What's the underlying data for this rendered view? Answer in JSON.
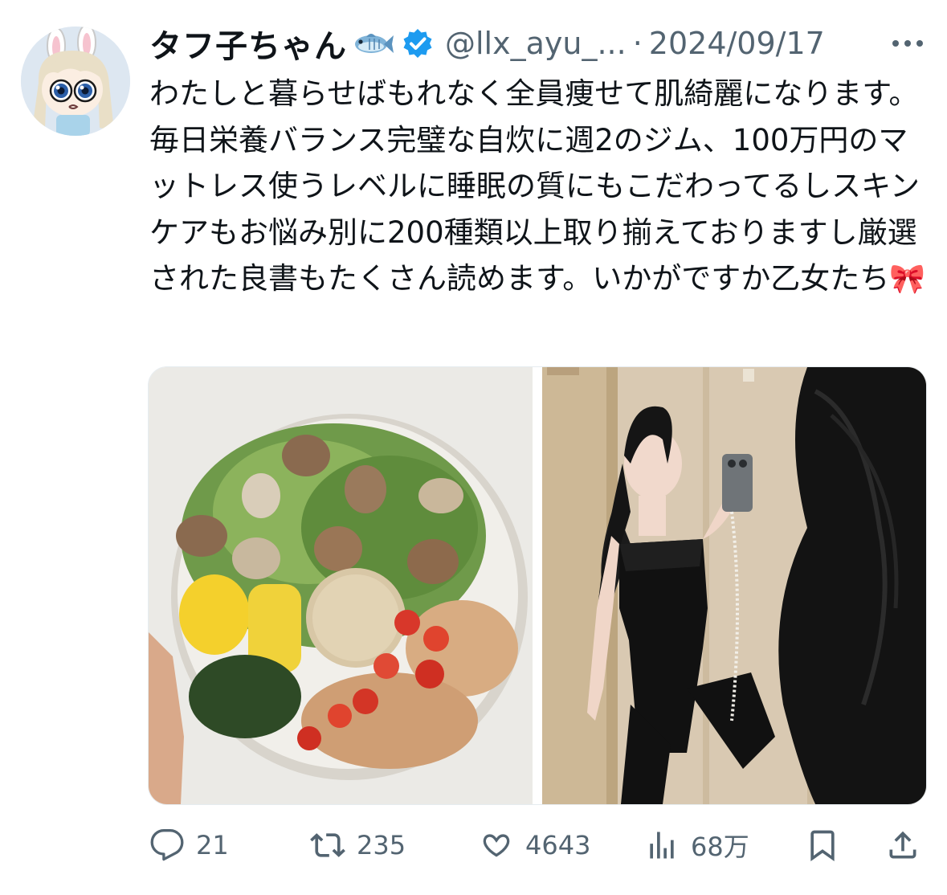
{
  "tweet": {
    "display_name": "タフ子ちゃん",
    "display_name_emoji_icon": "fish-icon",
    "verified_icon": "verified-badge-icon",
    "handle": "@llx_ayu_...",
    "separator": "·",
    "date": "2024/09/17",
    "text": "わたしと暮らせばもれなく全員痩せて肌綺麗になります。毎日栄養バランス完璧な自炊に週2のジム、100万円のマットレス使うレベルに睡眠の質にもこだわってるしスキンケアもお悩み別に200種類以上取り揃えておりますし厳選された良書もたくさん読めます。いかがですか乙女たち",
    "text_emoji_icon": "ribbon-icon",
    "images": [
      {
        "icon": "food-bowl-photo"
      },
      {
        "icon": "mirror-selfie-photo"
      }
    ]
  },
  "actions": {
    "reply": {
      "icon": "reply-icon",
      "count": "21"
    },
    "repost": {
      "icon": "repost-icon",
      "count": "235"
    },
    "like": {
      "icon": "heart-icon",
      "count": "4643"
    },
    "views": {
      "icon": "views-icon",
      "count": "68万"
    },
    "bookmark": {
      "icon": "bookmark-icon"
    },
    "share": {
      "icon": "share-icon"
    }
  },
  "colors": {
    "text": "#0f1419",
    "secondary": "#536471",
    "verified": "#1d9bf0"
  }
}
